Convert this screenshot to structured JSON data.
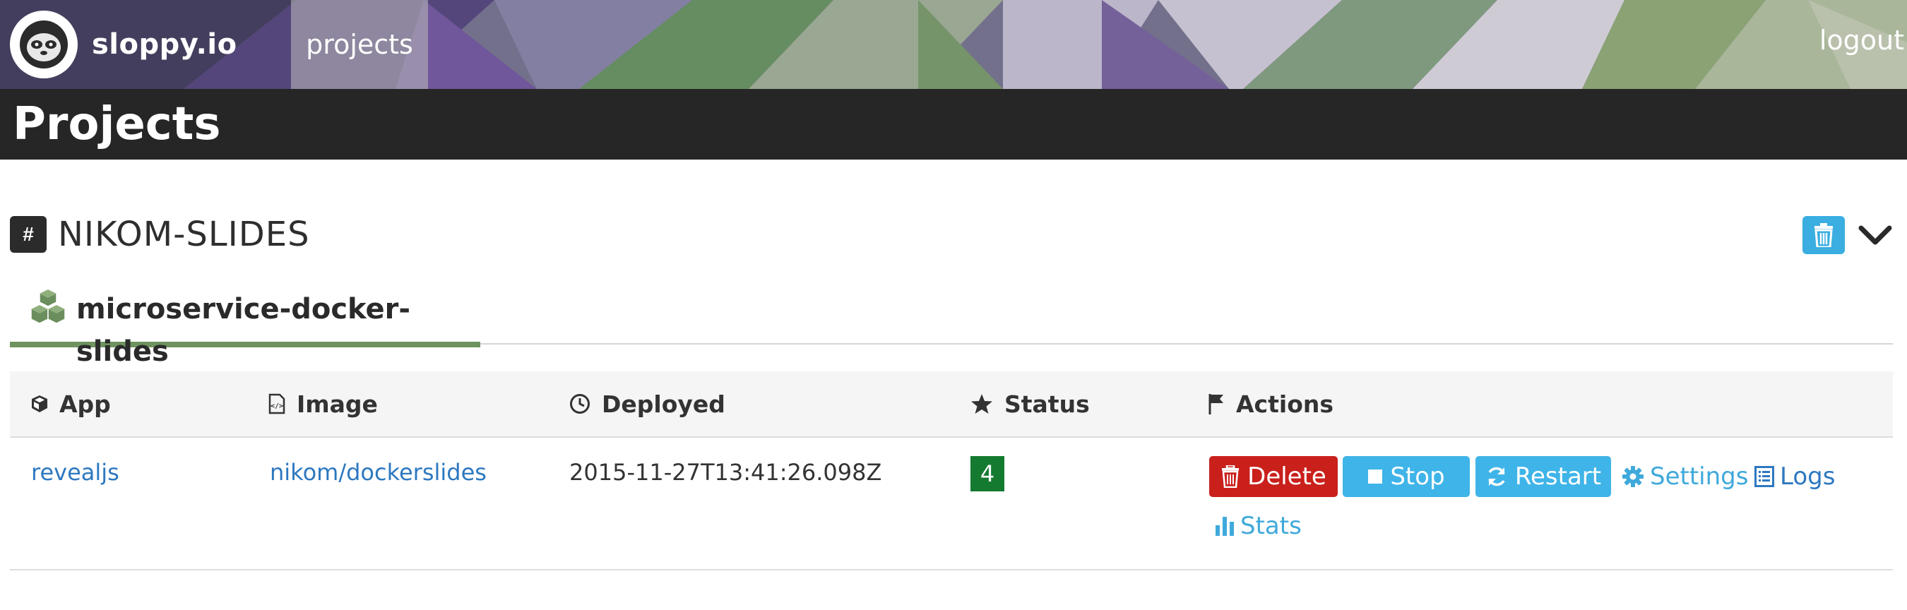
{
  "colors": {
    "topbar_accent": "#5d4a8a",
    "titlebar_bg": "#262626",
    "tab_underline": "#6e935e",
    "link": "#2d78c0",
    "info_button": "#3fb4e8",
    "danger_button": "#c9201c",
    "status_badge": "#147a30"
  },
  "nav": {
    "brand": "sloppy.io",
    "logo_icon": "sloth-icon",
    "projects_label": "projects",
    "logout_label": "logout"
  },
  "page": {
    "title": "Projects"
  },
  "project": {
    "hash_symbol": "#",
    "name": "NIKOM-SLIDES",
    "delete_icon": "trash-icon",
    "toggle_icon": "chevron-down-icon"
  },
  "service": {
    "icon": "cubes-icon",
    "name": "microservice-docker-slides"
  },
  "table": {
    "headers": [
      {
        "label": "App",
        "icon": "cube-icon"
      },
      {
        "label": "Image",
        "icon": "file-code-icon"
      },
      {
        "label": "Deployed",
        "icon": "clock-icon"
      },
      {
        "label": "Status",
        "icon": "star-icon"
      },
      {
        "label": "Actions",
        "icon": "flag-icon"
      }
    ],
    "rows": [
      {
        "app": "revealjs",
        "image": "nikom/dockerslides",
        "deployed": "2015-11-27T13:41:26.098Z",
        "status": "4",
        "actions": {
          "delete": "Delete",
          "stop": "Stop",
          "restart": "Restart",
          "settings": "Settings",
          "logs": "Logs",
          "stats": "Stats"
        }
      }
    ]
  }
}
